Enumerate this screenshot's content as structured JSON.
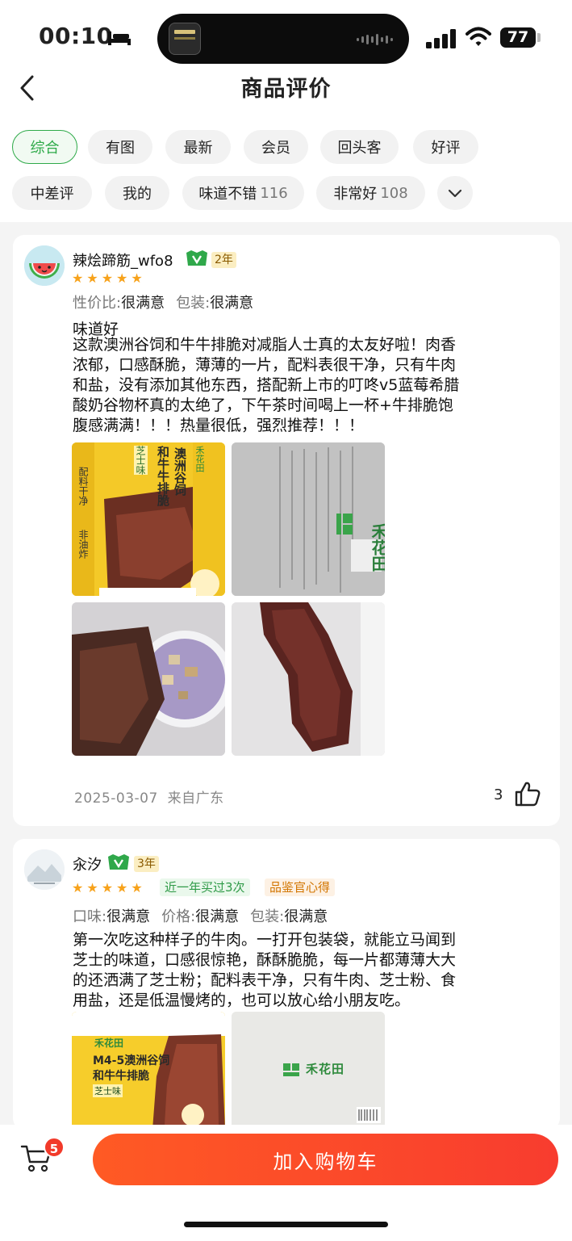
{
  "status": {
    "time": "00:10",
    "battery": "77"
  },
  "header": {
    "title": "商品评价"
  },
  "filters": [
    {
      "label": "综合",
      "count": "",
      "active": true
    },
    {
      "label": "有图",
      "count": ""
    },
    {
      "label": "最新",
      "count": ""
    },
    {
      "label": "会员",
      "count": ""
    },
    {
      "label": "回头客",
      "count": ""
    },
    {
      "label": "好评",
      "count": ""
    },
    {
      "label": "中差评",
      "count": ""
    },
    {
      "label": "我的",
      "count": ""
    },
    {
      "label": "味道不错",
      "count": "116"
    },
    {
      "label": "非常好",
      "count": "108"
    }
  ],
  "reviews": [
    {
      "user": "辣烩蹄筋_wfo8",
      "member_years": "2年",
      "stars": 5,
      "ratings": [
        {
          "label": "性价比",
          "value": "很满意"
        },
        {
          "label": "包装",
          "value": "很满意"
        }
      ],
      "title": "味道好",
      "lines": [
        "这款澳洲谷饲和牛牛排脆对减脂人士真的太友好啦！肉香",
        "浓郁，口感酥脆，薄薄的一片，配料表很干净，只有牛肉",
        "和盐，没有添加其他东西，搭配新上市的叮咚v5蓝莓希腊",
        "酸奶谷物杯真的太绝了，下午茶时间喝上一杯+牛排脆饱",
        "腹感满满！！！热量很低，强烈推荐！！！"
      ],
      "photo_labels": [
        "芝士味",
        "澳洲谷饲",
        "和牛牛排脆",
        "配料干净",
        "非油炸",
        "禾花田"
      ],
      "date": "2025-03-07",
      "location": "来自广东",
      "likes": "3"
    },
    {
      "user": "汆汐",
      "member_years": "3年",
      "stars": 5,
      "tags": [
        "近一年买过3次",
        "品鉴官心得"
      ],
      "ratings": [
        {
          "label": "口味",
          "value": "很满意"
        },
        {
          "label": "价格",
          "value": "很满意"
        },
        {
          "label": "包装",
          "value": "很满意"
        }
      ],
      "lines": [
        "第一次吃这种样子的牛肉。一打开包装袋，就能立马闻到",
        "芝士的味道，口感很惊艳，酥酥脆脆，每一片都薄薄大大",
        "的还洒满了芝士粉；配料表干净，只有牛肉、芝士粉、食",
        "用盐，还是低温慢烤的，也可以放心给小朋友吃。"
      ],
      "photo_labels": [
        "禾花田",
        "M4-5澳洲谷饲",
        "和牛牛排脆",
        "芝士味",
        "禾花田"
      ]
    }
  ],
  "bottom": {
    "cart_count": "5",
    "add_to_cart": "加入购物车"
  },
  "colors": {
    "accent_green": "#2eaa49",
    "star": "#f7a21b",
    "cta": "#f83c2f"
  }
}
